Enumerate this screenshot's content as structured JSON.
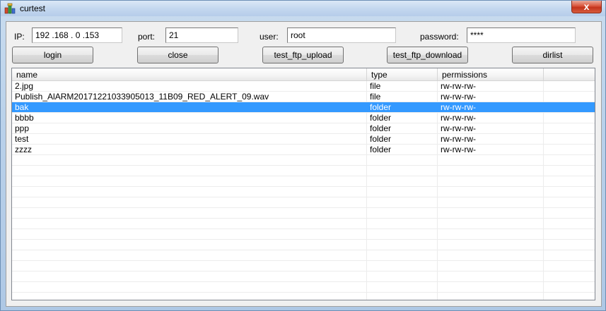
{
  "window": {
    "title": "curtest",
    "close_glyph": "x",
    "icon": "app-blocks-icon"
  },
  "connection": {
    "ip_label": "IP:",
    "ip_value": "192 .168 .  0  .153",
    "port_label": "port:",
    "port_value": "21",
    "user_label": "user:",
    "user_value": "root",
    "password_label": "password:",
    "password_value": "****"
  },
  "toolbar": {
    "login": "login",
    "close": "close",
    "upload": "test_ftp_upload",
    "download": "test_ftp_download",
    "dirlist": "dirlist"
  },
  "listview": {
    "columns": [
      "name",
      "type",
      "permissions"
    ],
    "selected_index": 2,
    "rows": [
      {
        "name": "2.jpg",
        "type": "file",
        "permissions": "rw-rw-rw-"
      },
      {
        "name": "Publish_AlARM20171221033905013_11B09_RED_ALERT_09.wav",
        "type": "file",
        "permissions": "rw-rw-rw-"
      },
      {
        "name": "bak",
        "type": "folder",
        "permissions": "rw-rw-rw-"
      },
      {
        "name": "bbbb",
        "type": "folder",
        "permissions": "rw-rw-rw-"
      },
      {
        "name": "ppp",
        "type": "folder",
        "permissions": "rw-rw-rw-"
      },
      {
        "name": "test",
        "type": "folder",
        "permissions": "rw-rw-rw-"
      },
      {
        "name": "zzzz",
        "type": "folder",
        "permissions": "rw-rw-rw-"
      }
    ]
  },
  "colors": {
    "selection": "#3399ff",
    "close_button": "#d9543b"
  }
}
